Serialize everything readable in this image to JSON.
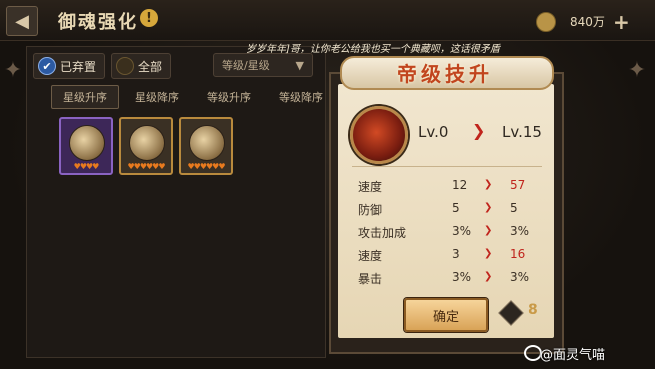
{
  "header": {
    "title": "御魂强化",
    "badge": "!",
    "coin_value": "840万",
    "plus": "+"
  },
  "filters": {
    "discarded_label": "已弃置",
    "all_label": "全部",
    "sort_dropdown": "等级/星级",
    "dropdown_arrow": "▼"
  },
  "sort_tabs": [
    "星级升序",
    "星级降序",
    "等级升序",
    "等级降序"
  ],
  "cards": [
    {
      "stars": "♥♥♥♥",
      "selected": true
    },
    {
      "stars": "♥♥♥♥♥♥",
      "selected": false
    },
    {
      "stars": "♥♥♥♥♥♥",
      "selected": false
    }
  ],
  "dialog": {
    "speech": "岁岁年年]哥，让你老公给我也买一个典藏呗，这话很矛盾",
    "title": "帝级技升",
    "level_from": "Lv.0",
    "level_to": "Lv.15",
    "arrow": "❯",
    "stats": [
      {
        "name": "速度",
        "from": "12",
        "to": "57",
        "up": true
      },
      {
        "name": "防御",
        "from": "5",
        "to": "5",
        "up": false
      },
      {
        "name": "攻击加成",
        "from": "3%",
        "to": "3%",
        "up": false
      },
      {
        "name": "速度",
        "from": "3",
        "to": "16",
        "up": true
      },
      {
        "name": "暴击",
        "from": "3%",
        "to": "3%",
        "up": false
      }
    ],
    "confirm_label": "确定",
    "resource_count": "8"
  },
  "watermark": "@面灵气喵",
  "colors": {
    "accent_red": "#c0241c",
    "gold": "#d9a357",
    "scroll_bg": "#efe2c8"
  }
}
